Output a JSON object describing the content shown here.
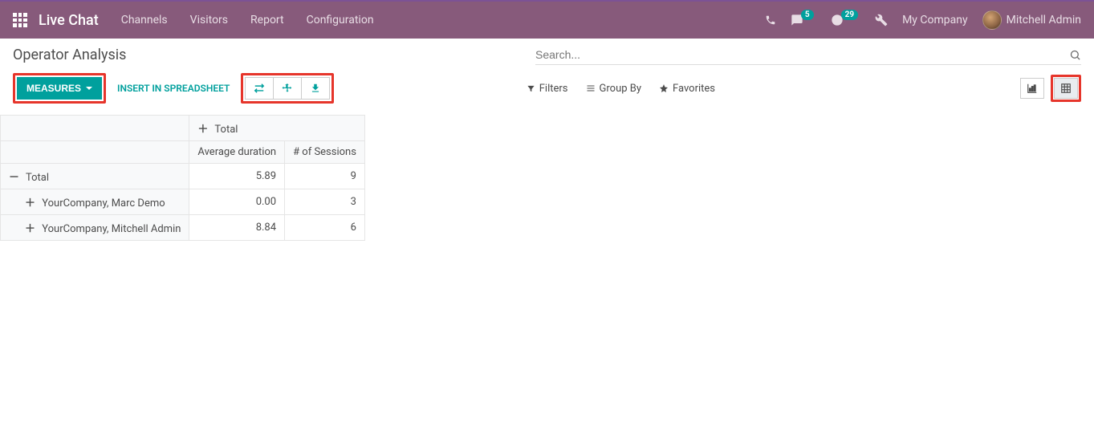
{
  "header": {
    "brand": "Live Chat",
    "menu": [
      "Channels",
      "Visitors",
      "Report",
      "Configuration"
    ],
    "badges": {
      "messages": "5",
      "activities": "29"
    },
    "company": "My Company",
    "user": "Mitchell Admin"
  },
  "page": {
    "title": "Operator Analysis",
    "search_placeholder": "Search..."
  },
  "toolbar": {
    "measures_label": "MEASURES",
    "insert_label": "INSERT IN SPREADSHEET"
  },
  "control": {
    "filters": "Filters",
    "groupby": "Group By",
    "favorites": "Favorites"
  },
  "pivot": {
    "col_total_label": "Total",
    "measures": [
      "Average duration",
      "# of Sessions"
    ],
    "rows": [
      {
        "label": "Total",
        "expanded": true,
        "indent": 0,
        "values": [
          "5.89",
          "9"
        ]
      },
      {
        "label": "YourCompany, Marc Demo",
        "expanded": false,
        "indent": 1,
        "values": [
          "0.00",
          "3"
        ]
      },
      {
        "label": "YourCompany, Mitchell Admin",
        "expanded": false,
        "indent": 1,
        "values": [
          "8.84",
          "6"
        ]
      }
    ]
  },
  "chart_data": {
    "type": "table",
    "title": "Operator Analysis",
    "columns": [
      "Average duration",
      "# of Sessions"
    ],
    "rows": [
      {
        "operator": "Total",
        "average_duration": 5.89,
        "sessions": 9
      },
      {
        "operator": "YourCompany, Marc Demo",
        "average_duration": 0.0,
        "sessions": 3
      },
      {
        "operator": "YourCompany, Mitchell Admin",
        "average_duration": 8.84,
        "sessions": 6
      }
    ]
  }
}
